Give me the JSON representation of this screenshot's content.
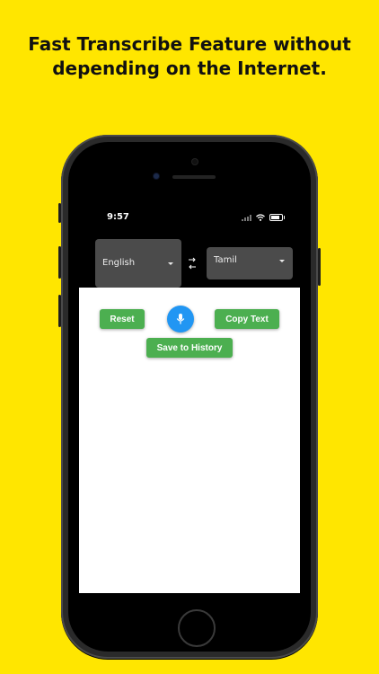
{
  "headline": "Fast Transcribe Feature without\ndepending on the Internet.",
  "colors": {
    "background": "#ffe600",
    "phone_body": "#2a2a2a",
    "dropdown": "#4b4b4b",
    "action_button": "#4caf50",
    "mic_button": "#2196f3"
  },
  "status_bar": {
    "time": "9:57",
    "icons": [
      "signal-icon",
      "wifi-icon",
      "battery-icon"
    ]
  },
  "language_selector": {
    "source": "English",
    "target": "Tamil",
    "swap_icon": "swap-arrows-icon"
  },
  "actions": {
    "reset_label": "Reset",
    "copy_label": "Copy Text",
    "save_label": "Save to History",
    "mic_icon": "microphone-icon"
  }
}
